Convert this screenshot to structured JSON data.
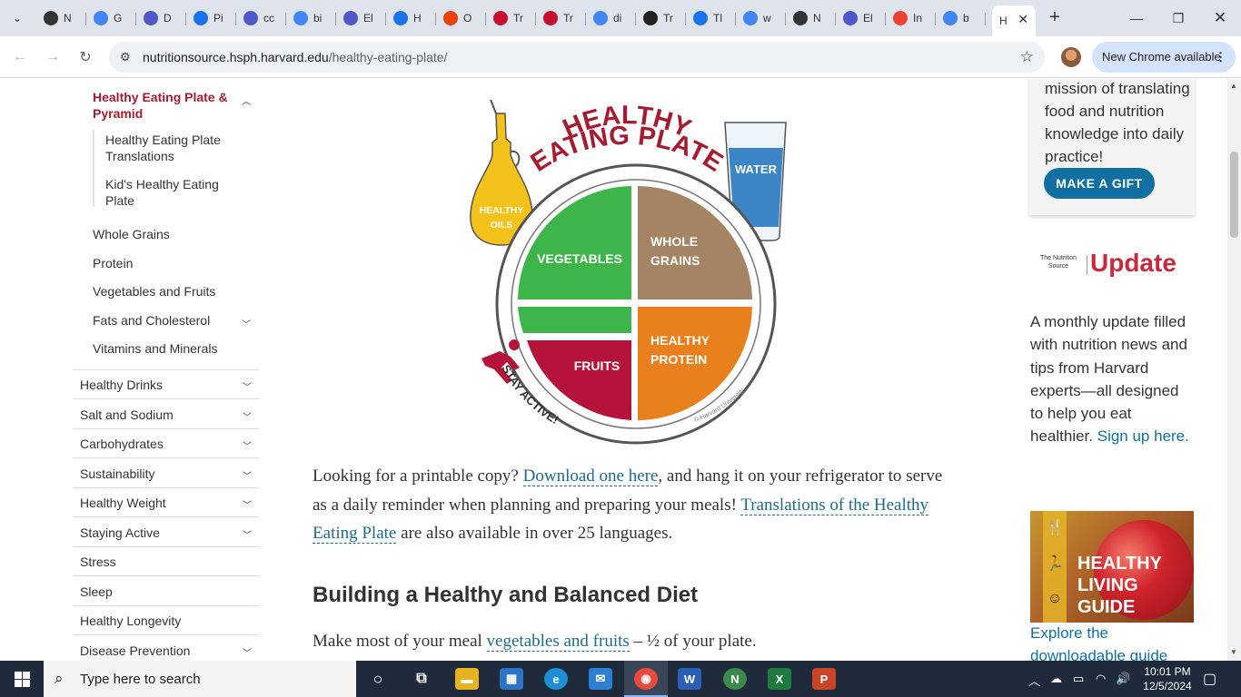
{
  "browser": {
    "tabs": [
      {
        "label": "N",
        "favicon": "github-icon",
        "color": "#333333"
      },
      {
        "label": "G",
        "favicon": "google-icon",
        "color": "#4285f4"
      },
      {
        "label": "D",
        "favicon": "teams-icon",
        "color": "#5059c9"
      },
      {
        "label": "Pi",
        "favicon": "chatgpt-icon",
        "color": "#1a73e8"
      },
      {
        "label": "cc",
        "favicon": "teams-icon",
        "color": "#5059c9"
      },
      {
        "label": "bi",
        "favicon": "google-icon",
        "color": "#4285f4"
      },
      {
        "label": "El",
        "favicon": "teams-icon",
        "color": "#5059c9"
      },
      {
        "label": "H",
        "favicon": "chatgpt-icon",
        "color": "#1a73e8"
      },
      {
        "label": "O",
        "favicon": "office-icon",
        "color": "#e8410d"
      },
      {
        "label": "Tr",
        "favicon": "trello-icon",
        "color": "#c8102e"
      },
      {
        "label": "Tr",
        "favicon": "trello-icon",
        "color": "#c8102e"
      },
      {
        "label": "di",
        "favicon": "google-icon",
        "color": "#4285f4"
      },
      {
        "label": "Tr",
        "favicon": "amazon-icon",
        "color": "#222222"
      },
      {
        "label": "Tl",
        "favicon": "chatgpt-icon",
        "color": "#1a73e8"
      },
      {
        "label": "w",
        "favicon": "google-icon",
        "color": "#4285f4"
      },
      {
        "label": "N",
        "favicon": "github-icon",
        "color": "#333333"
      },
      {
        "label": "El",
        "favicon": "teams-icon",
        "color": "#5059c9"
      },
      {
        "label": "In",
        "favicon": "gmail-icon",
        "color": "#ea4335"
      },
      {
        "label": "b",
        "favicon": "google-icon",
        "color": "#4285f4"
      }
    ],
    "active_tab": {
      "label": "H"
    },
    "url_domain": "nutritionsource.hsph.harvard.edu",
    "url_path": "/healthy-eating-plate/",
    "new_chrome_label": "New Chrome available"
  },
  "sidebar": {
    "active_item": "Healthy Eating Plate & Pyramid",
    "sub_items": [
      "Healthy Eating Plate Translations",
      "Kid's Healthy Eating Plate"
    ],
    "section_items": [
      "Whole Grains",
      "Protein",
      "Vegetables and Fruits",
      "Fats and Cholesterol",
      "Vitamins and Minerals"
    ],
    "main_items": [
      {
        "label": "Healthy Drinks",
        "expandable": true
      },
      {
        "label": "Salt and Sodium",
        "expandable": true
      },
      {
        "label": "Carbohydrates",
        "expandable": true
      },
      {
        "label": "Sustainability",
        "expandable": true
      },
      {
        "label": "Healthy Weight",
        "expandable": true
      },
      {
        "label": "Staying Active",
        "expandable": true
      },
      {
        "label": "Stress",
        "expandable": false
      },
      {
        "label": "Sleep",
        "expandable": false
      },
      {
        "label": "Healthy Longevity",
        "expandable": false
      },
      {
        "label": "Disease Prevention",
        "expandable": true
      }
    ]
  },
  "plate": {
    "title_line1": "HEALTHY",
    "title_line2": "EATING PLATE",
    "water": "WATER",
    "oils_line1": "HEALTHY",
    "oils_line2": "OILS",
    "vegetables": "VEGETABLES",
    "grains_line1": "WHOLE",
    "grains_line2": "GRAINS",
    "fruits": "FRUITS",
    "protein_line1": "HEALTHY",
    "protein_line2": "PROTEIN",
    "stay_active": "STAY ACTIVE!",
    "copyright": "© Harvard University"
  },
  "article": {
    "p1_before": "Looking for a printable copy? ",
    "p1_link1": "Download one here",
    "p1_mid": ", and hang it on your refrigerator to serve as a daily reminder when planning and preparing your meals! ",
    "p1_link2": "Translations of the Healthy Eating Plate",
    "p1_after": " are also available in over 25 languages.",
    "heading": "Building a Healthy and Balanced Diet",
    "p2_before": "Make most of your meal ",
    "p2_link": "vegetables and fruits",
    "p2_after": " – ½ of your plate."
  },
  "right": {
    "donate_text": "mission of translating food and nutrition knowledge into daily practice!",
    "gift_button": "MAKE A GIFT",
    "update_small": "The Nutrition Source",
    "update_big": "Update",
    "update_text": "A monthly update filled with nutrition news and tips from Harvard experts—all designed to help you eat healthier. ",
    "signup_link": "Sign up here.",
    "guide_title": "HEALTHY LIVING GUIDE",
    "guide_link": "Explore the downloadable guide"
  },
  "taskbar": {
    "search_placeholder": "Type here to search",
    "time": "10:01 PM",
    "date": "12/5/2024"
  }
}
